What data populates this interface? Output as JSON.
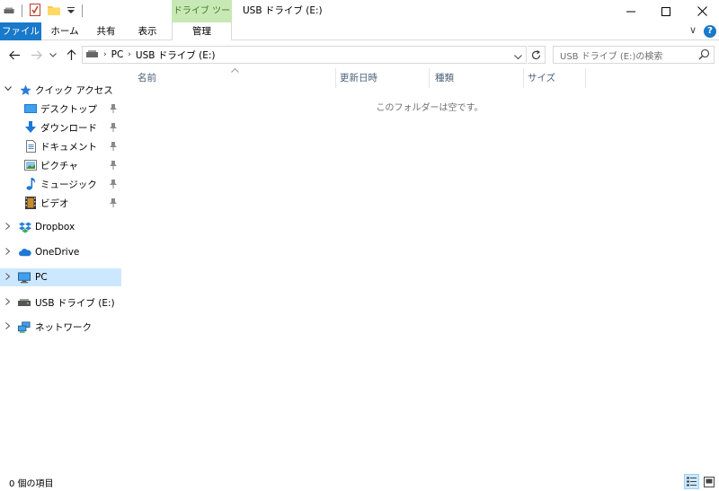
{
  "window": {
    "title": "USB ドライブ (E:)",
    "context_tab": "ドライブ ツール",
    "buttons": {
      "minimize": "—",
      "maximize": "☐",
      "close": "✕"
    }
  },
  "ribbon": {
    "tabs": [
      {
        "label": "ファイル"
      },
      {
        "label": "ホーム"
      },
      {
        "label": "共有"
      },
      {
        "label": "表示"
      },
      {
        "label": "管理"
      }
    ],
    "expand_glyph": "∨",
    "help_glyph": "?"
  },
  "address": {
    "crumbs": [
      "PC",
      "USB ドライブ (E:)"
    ],
    "search_placeholder": "USB ドライブ (E:)の検索"
  },
  "nav": {
    "items": [
      {
        "label": "クイック アクセス",
        "icon": "star-icon"
      },
      {
        "label": "デスクトップ",
        "icon": "desktop-icon"
      },
      {
        "label": "ダウンロード",
        "icon": "download-icon"
      },
      {
        "label": "ドキュメント",
        "icon": "document-icon"
      },
      {
        "label": "ピクチャ",
        "icon": "picture-icon"
      },
      {
        "label": "ミュージック",
        "icon": "music-icon"
      },
      {
        "label": "ビデオ",
        "icon": "video-icon"
      },
      {
        "label": "Dropbox",
        "icon": "dropbox-icon"
      },
      {
        "label": "OneDrive",
        "icon": "onedrive-icon"
      },
      {
        "label": "PC",
        "icon": "pc-icon"
      },
      {
        "label": "USB ドライブ (E:)",
        "icon": "usb-drive-icon"
      },
      {
        "label": "ネットワーク",
        "icon": "network-icon"
      }
    ]
  },
  "columns": [
    {
      "label": "名前"
    },
    {
      "label": "更新日時"
    },
    {
      "label": "種類"
    },
    {
      "label": "サイズ"
    }
  ],
  "empty_message": "このフォルダーは空です。",
  "status": {
    "item_count": "0 個の項目"
  },
  "colors": {
    "accent": "#1979ca",
    "context_tab": "#c8e9b5",
    "selection": "#cce8ff",
    "header_text": "#4c607a"
  }
}
